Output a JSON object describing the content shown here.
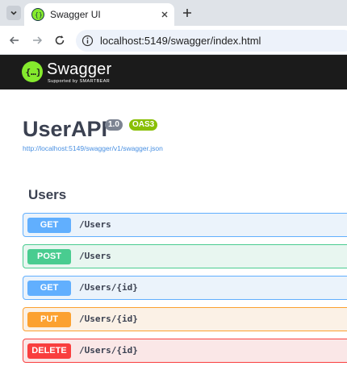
{
  "browser": {
    "tab_title": "Swagger UI",
    "url": "localhost:5149/swagger/index.html"
  },
  "topbar": {
    "logo_text": "Swagger",
    "logo_subtext": "Supported by SMARTBEAR"
  },
  "info": {
    "title": "UserAPI",
    "version": "1.0",
    "oas": "OAS3",
    "spec_url": "http://localhost:5149/swagger/v1/swagger.json"
  },
  "section": {
    "title": "Users"
  },
  "operations": [
    {
      "method": "GET",
      "path": "/Users"
    },
    {
      "method": "POST",
      "path": "/Users"
    },
    {
      "method": "GET",
      "path": "/Users/{id}"
    },
    {
      "method": "PUT",
      "path": "/Users/{id}"
    },
    {
      "method": "DELETE",
      "path": "/Users/{id}"
    }
  ],
  "colors": {
    "get": "#61affe",
    "post": "#49cc90",
    "put": "#fca130",
    "delete": "#f93e3e",
    "swagger_green": "#85ea2d"
  }
}
